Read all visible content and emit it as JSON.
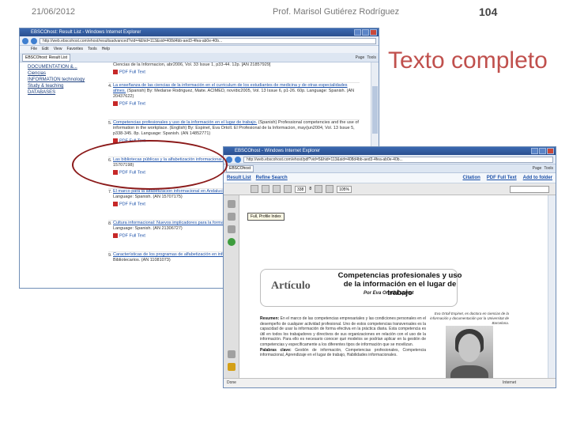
{
  "slide": {
    "date": "21/06/2012",
    "author": "Prof. Marisol Gutiérez Rodríguez",
    "page_number": "104",
    "title": "Texto completo"
  },
  "window1": {
    "title": "EBSCOhost: Result List - Windows Internet Explorer",
    "url": "http://web.ebscohost.com/ehost/resultsadvanced?vid=4&hid=113&sid=408d4bb-aed3-4fea-ab0e-40b...",
    "menu": [
      "File",
      "Edit",
      "View",
      "Favorites",
      "Tools",
      "Help"
    ],
    "tab": "EBSCOhost: Result List",
    "tools": [
      "Page",
      "Tools"
    ],
    "sidebar": [
      "DOCUMENTATION &...",
      "Ciencias",
      "INFORMATION technology",
      "Study & teaching",
      "DATABASES"
    ],
    "records": [
      {
        "num": "",
        "title": "",
        "text": "Ciencias de la Informacion, abr2006, Vol. 33 Issue 1, p33-44. 12p. [AN 21857929]",
        "pdf": "PDF Full Text"
      },
      {
        "num": "4.",
        "title": "La enseñanza de las ciencias de la información en el curriculum de los estudiantes de medicina y de otras especialidades afines.",
        "text": "(Spanish) By: Medarse Rodriguez, Maite. ACIMED, nov/dic2005, Vol. 13 Issue 6, p1-26. 60p. Language: Spanish. (AN 20437622)",
        "pdf": "PDF Full Text"
      },
      {
        "num": "5.",
        "title": "Competencias profesionales y uso de la información en el lugar de trabajo.",
        "text": "(Spanish) Professional competencies and the use of information in the workplace. (English) By: Espinet, Eva Ortoll. El Profesional de la Informacion, may/jun2004, Vol. 13 Issue 5, p338-345. 8p. Language: Spanish. (AN 14852771)",
        "pdf": "PDF Full Text"
      },
      {
        "num": "6.",
        "title": "Las bibliotecas públicas y la alfabetización informacional.",
        "text": "(Spanish) Boletín de la Asociación Andaluza de Bibliotecarios... (AN 15707198)",
        "pdf": "PDF Full Text"
      },
      {
        "num": "7.",
        "title": "El marco para la alfabetización informacional en Andalucía.",
        "text": "(Spanish) Boletín de la Asociación Andaluza de Bibliotecarios. Language: Spanish. (AN 15707175)",
        "pdf": "PDF Full Text"
      },
      {
        "num": "8.",
        "title": "Cultura informacional: Nuevos implicadores para la formación de usuarios.",
        "text": "Ciencias de la Informacion, abr2003, Vol. 34 Issue 1. Language: Spanish. (AN 21306727)",
        "pdf": "PDF Full Text"
      },
      {
        "num": "9.",
        "title": "Características de los programas de alfabetización en información.",
        "text": "(Spanish) Boletín de la Asociación Andaluza de Bibliotecarios. (AN 11081073)",
        "pdf": "PDF Full Text"
      }
    ]
  },
  "window2": {
    "title": "EBSCOhost - Windows Internet Explorer",
    "url": "http://web.ebscohost.com/ehost/pdf?vid=5&hid=113&sid=408d4bb-aed3-4fea-ab0e-40b...",
    "tab": "EBSCOhost",
    "tools": [
      "Page",
      "Tools"
    ],
    "nav": {
      "result_list": "Result List",
      "refine_search": "Refine Search",
      "citation": "Citation",
      "pdf_full_text": "PDF Full Text",
      "add_folder": "Add to folder"
    },
    "pdf": {
      "page_field": "338",
      "page_total": "8",
      "zoom": "105%",
      "tooltip": "Full, Profile Index"
    },
    "article": {
      "section": "Artículo",
      "title": "Competencias profesionales y uso de la información en el lugar de trabajo",
      "author": "Por Eva Ortoll Espinet",
      "abstract_label": "Resumen:",
      "abstract": "En el marco de las competencias empresariales y las condiciones personales en el desempeño de cualquier actividad profesional. Uno de estos competencias transversales es la capacidad de usar la información de forma efectiva en la práctica diaria. Esta competencia es útil en todos los trabajadores y directivos de sus organizaciones en relación con el uso de la información. Para ello es necesario conocer qué modelos se podrían aplicar en la gestión de competencias y específicamente a los diferentes tipos de información que se movilizan.",
      "keywords_label": "Palabras clave:",
      "keywords": "Gestión de información, Competencias profesionales, Competencia informacional, Aprendizaje en el lugar de trabajo, Habilidades informacionales.",
      "bio": "Eva Ortoll Espinet, es doctora en ciencias de la información y documentación por la Universitat de Barcelona.",
      "bio2": "Profesora de la Universitat Oberta de Catalunya."
    },
    "status": "Done",
    "status_zone": "Internet"
  }
}
